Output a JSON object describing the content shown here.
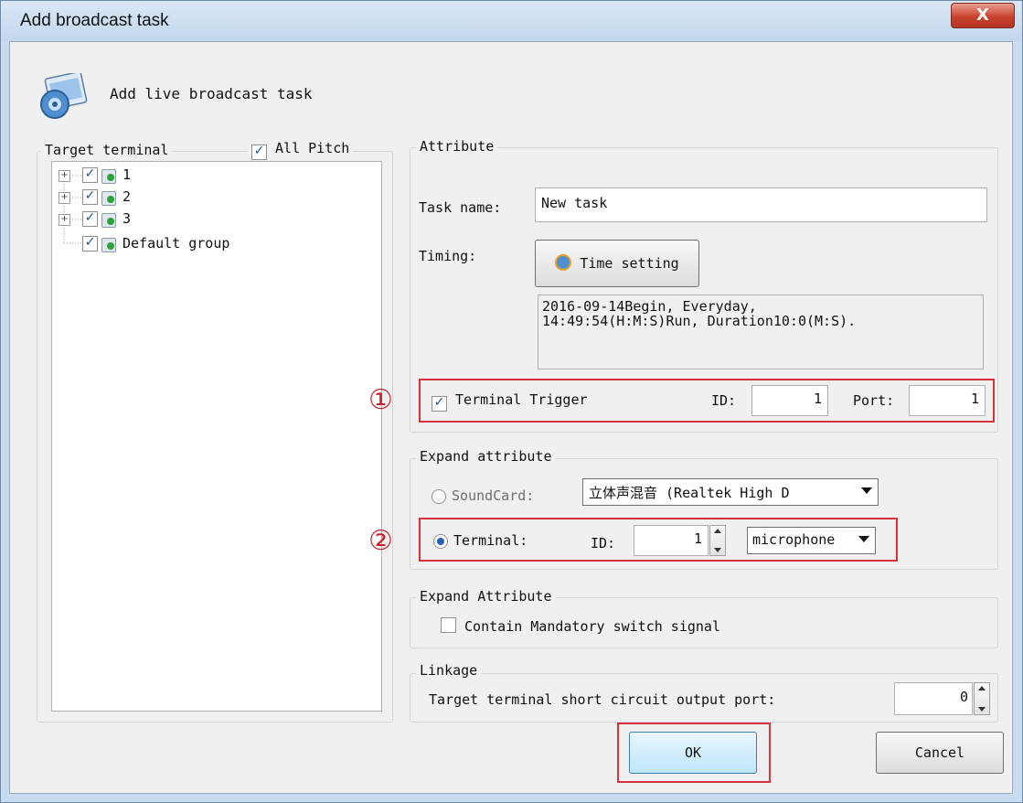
{
  "window": {
    "title": "Add broadcast task",
    "close_glyph": "X"
  },
  "header": {
    "text": "Add live broadcast task",
    "icon": "broadcast-task-icon"
  },
  "target_terminal": {
    "label": "Target terminal",
    "all_pitch_label": "All Pitch",
    "all_pitch_checked": true,
    "items": [
      {
        "label": "1",
        "expander": "+",
        "checked": true
      },
      {
        "label": "2",
        "expander": "+",
        "checked": true
      },
      {
        "label": "3",
        "expander": "+",
        "checked": true
      },
      {
        "label": "Default group",
        "expander": "",
        "checked": true
      }
    ]
  },
  "attribute": {
    "title": "Attribute",
    "task_name_label": "Task name:",
    "task_name_value": "New task",
    "timing_label": "Timing:",
    "time_setting_label": "Time setting",
    "timing_info_line1": "2016-09-14Begin, Everyday,",
    "timing_info_line2": "14:49:54(H:M:S)Run, Duration10:0(M:S).",
    "marker1": "①",
    "terminal_trigger_label": "Terminal Trigger",
    "terminal_trigger_checked": true,
    "id_label": "ID:",
    "id_value": "1",
    "port_label": "Port:",
    "port_value": "1"
  },
  "expand_attribute": {
    "title": "Expand attribute",
    "soundcard_label": "SoundCard:",
    "soundcard_value": "立体声混音 (Realtek High D",
    "marker2": "②",
    "terminal_label": "Terminal:",
    "terminal_selected": true,
    "id_label": "ID:",
    "id_value": "1",
    "source_value": "microphone"
  },
  "expand_attribute2": {
    "title": "Expand Attribute",
    "mandatory_label": "Contain Mandatory switch signal",
    "mandatory_checked": false
  },
  "linkage": {
    "title": "Linkage",
    "port_label": "Target terminal short circuit output port:",
    "port_value": "0"
  },
  "buttons": {
    "ok": "OK",
    "cancel": "Cancel"
  },
  "colors": {
    "accent_red": "#d8333a",
    "title_bar": "#c9dcef"
  }
}
